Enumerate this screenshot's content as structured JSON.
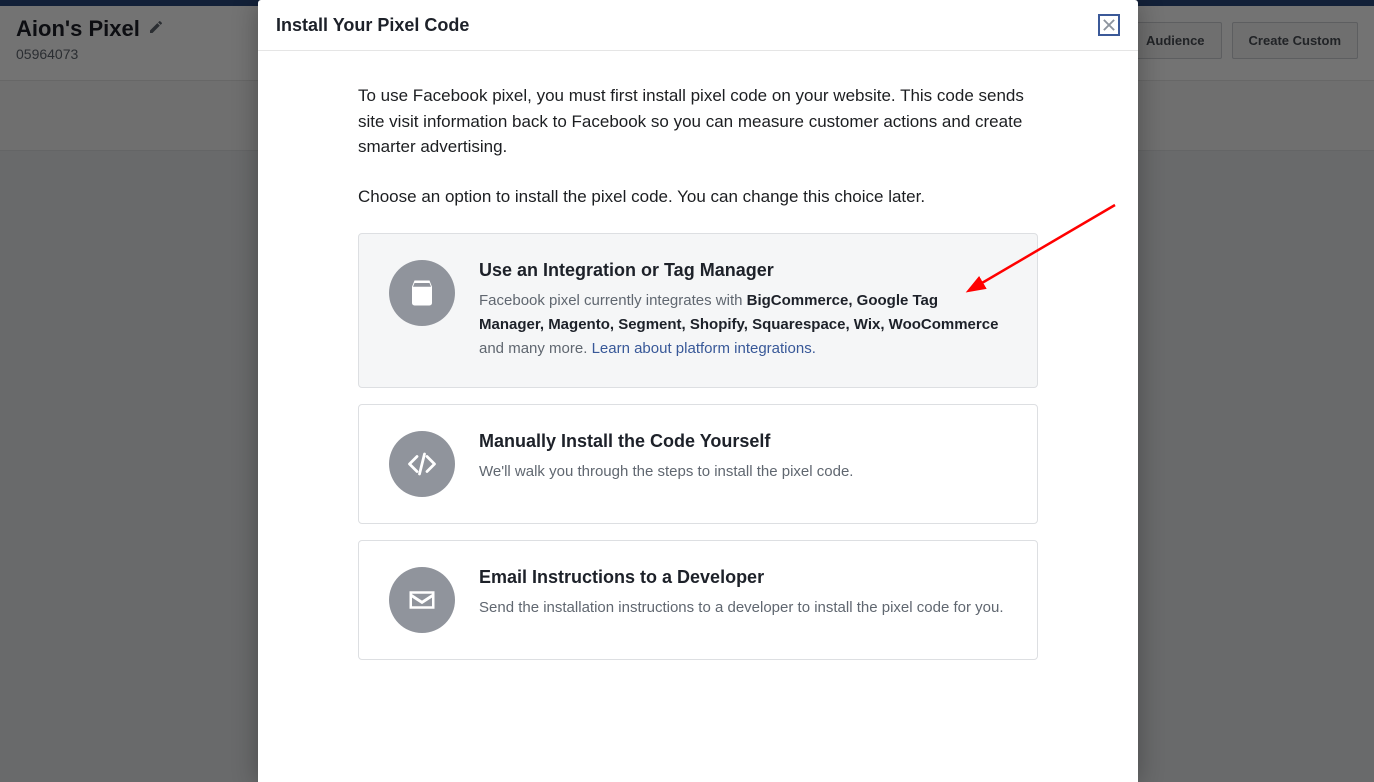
{
  "background": {
    "pixel_title": "Aion's Pixel",
    "pixel_id": "05964073",
    "button_audience": "Audience",
    "button_create_custom": "Create Custom"
  },
  "modal": {
    "title": "Install Your Pixel Code",
    "intro": "To use Facebook pixel, you must first install pixel code on your website. This code sends site visit information back to Facebook so you can measure customer actions and create smarter advertising.",
    "choose": "Choose an option to install the pixel code. You can change this choice later.",
    "options": {
      "integration": {
        "title": "Use an Integration or Tag Manager",
        "desc_prefix": "Facebook pixel currently integrates with ",
        "platforms": "BigCommerce, Google Tag Manager, Magento, Segment, Shopify, Squarespace, Wix, WooCommerce",
        "desc_suffix": " and many more. ",
        "link": "Learn about platform integrations."
      },
      "manual": {
        "title": "Manually Install the Code Yourself",
        "desc": "We'll walk you through the steps to install the pixel code."
      },
      "email": {
        "title": "Email Instructions to a Developer",
        "desc": "Send the installation instructions to a developer to install the pixel code for you."
      }
    }
  }
}
